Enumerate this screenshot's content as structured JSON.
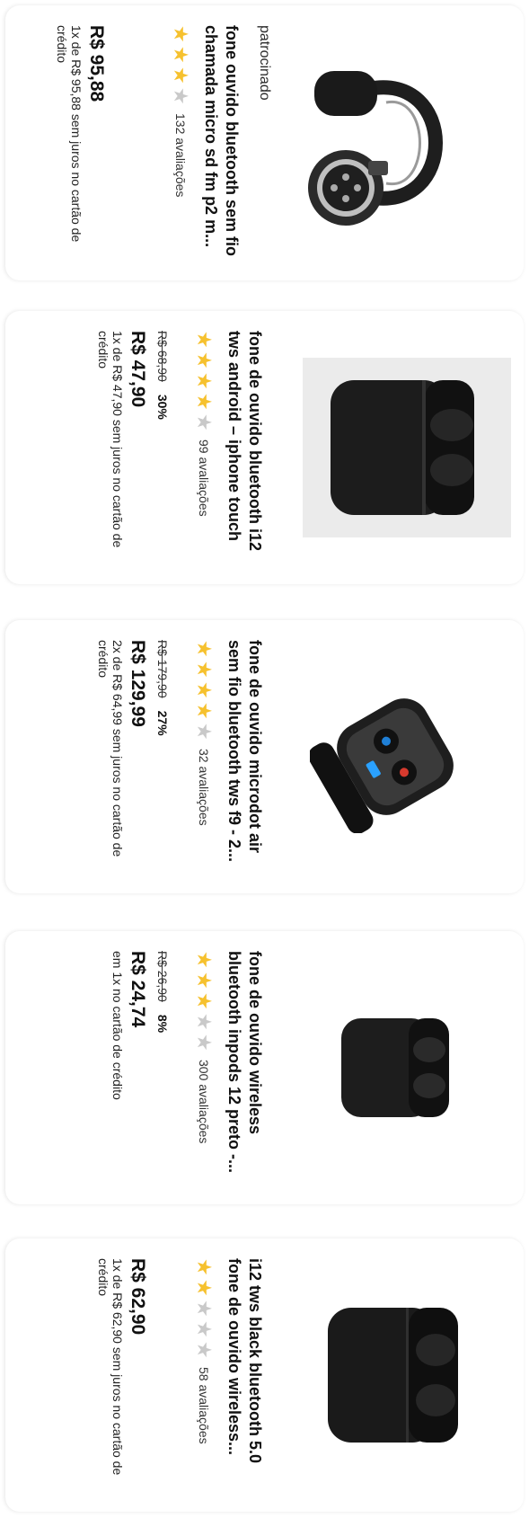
{
  "cards": [
    {
      "sponsored": "patrocinado",
      "title": "fone ouvido bluetooth sem fio chamada micro sd fm p2 m...",
      "stars": 3,
      "reviews": "132 avaliações",
      "old_price": "",
      "discount": "",
      "price": "R$ 95,88",
      "installments": "1x de R$ 95,88 sem juros no cartão de crédito",
      "image": "headphones-image"
    },
    {
      "sponsored": "",
      "title": "fone de ouvido bluetooth i12 tws android – iphone touch",
      "stars": 4,
      "reviews": "99 avaliações",
      "old_price": "R$ 68,90",
      "discount": "30%",
      "price": "R$ 47,90",
      "installments": "1x de R$ 47,90 sem juros no cartão de crédito",
      "image": "earbuds-case-image"
    },
    {
      "sponsored": "",
      "title": "fone de ouvido microdot air sem fio bluetooth tws f9 - 2...",
      "stars": 4,
      "reviews": "32 avaliações",
      "old_price": "R$ 179,90",
      "discount": "27%",
      "price": "R$ 129,99",
      "installments": "2x de R$ 64,99 sem juros no cartão de crédito",
      "image": "f9-earbuds-image"
    },
    {
      "sponsored": "",
      "title": "fone de ouvido wireless bluetooth inpods 12 preto -...",
      "stars": 3,
      "reviews": "300 avaliações",
      "old_price": "R$ 26,90",
      "discount": "8%",
      "price": "R$ 24,74",
      "installments": "em 1x no cartão de crédito",
      "image": "inpods-image"
    },
    {
      "sponsored": "",
      "title": "i12 tws black bluetooth 5.0 fone de ouvido wireless...",
      "stars": 2,
      "reviews": "58 avaliações",
      "old_price": "",
      "discount": "",
      "price": "R$ 62,90",
      "installments": "1x de R$ 62,90 sem juros no cartão de crédito",
      "image": "i12-black-image"
    }
  ]
}
